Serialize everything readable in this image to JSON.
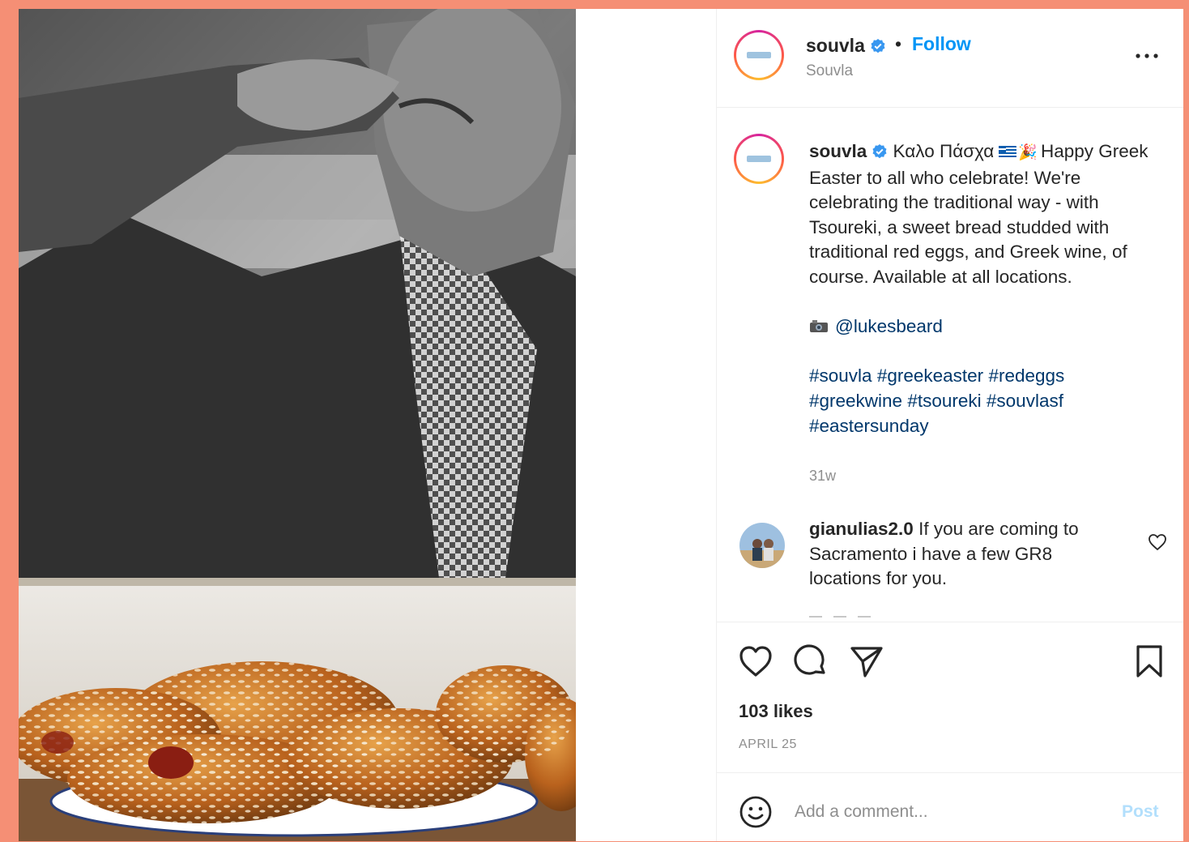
{
  "post": {
    "image_alt": "Black and white photo of a man drinking above a plate of braided Tsoureki bread with red eggs",
    "image_description": "photo-tsoureki"
  },
  "header": {
    "username": "souvla",
    "verified_icon": "verified-badge-icon",
    "separator": "•",
    "follow_label": "Follow",
    "subtitle": "Souvla",
    "more_icon": "more-options-icon"
  },
  "caption": {
    "username": "souvla",
    "greek_greeting": "Καλο Πάσχα",
    "flag_icon": "greek-flag-icon",
    "party_icon": "party-popper-icon",
    "line1_rest": "Happy Greek Easter to all who celebrate! We're celebrating the traditional way - with Tsoureki, a sweet bread studded with traditional red eggs, and Greek wine, of course. Available at all locations.",
    "camera_icon": "camera-icon",
    "photo_credit": "@lukesbeard",
    "hashtags": [
      "#souvla",
      "#greekeaster",
      "#redeggs",
      "#greekwine",
      "#tsoureki",
      "#souvlasf",
      "#eastersunday"
    ],
    "time_ago": "31w"
  },
  "comments": [
    {
      "username": "gianulias2.0",
      "text": "If you are coming to Sacramento i have a few GR8 locations for you."
    }
  ],
  "actions": {
    "like_icon": "heart-icon",
    "comment_icon": "comment-bubble-icon",
    "share_icon": "send-paper-plane-icon",
    "save_icon": "bookmark-icon",
    "likes": "103 likes",
    "date": "APRIL 25"
  },
  "add_comment": {
    "emoji_icon": "emoji-smiley-icon",
    "placeholder": "Add a comment...",
    "post_label": "Post"
  },
  "colors": {
    "background": "#f58f75",
    "link_blue": "#0095f6",
    "hashtag": "#00376b",
    "muted": "#8e8e8e",
    "post_disabled": "#b2dffc"
  }
}
